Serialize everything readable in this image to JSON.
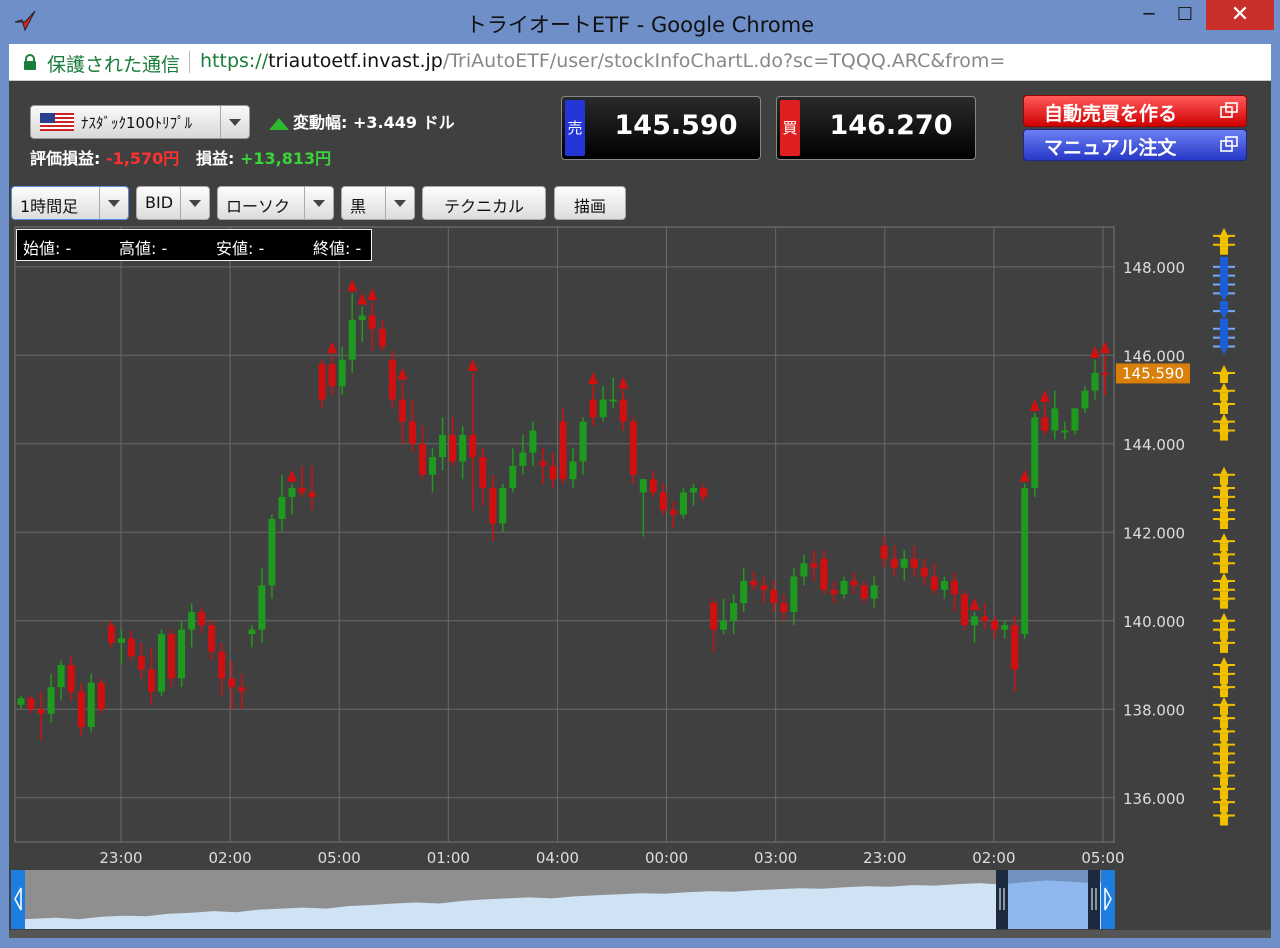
{
  "window": {
    "title": "トライオートETF - Google Chrome",
    "minimize": "─",
    "maximize": "☐",
    "close": "✕"
  },
  "address": {
    "secure_label": "保護された通信",
    "url_scheme": "https://",
    "url_host": "triautoetf.invast.jp",
    "url_path": "/TriAutoETF/user/stockInfoChartL.do?sc=TQQQ.ARC&from="
  },
  "header": {
    "symbol": "ﾅｽﾀﾞｯｸ100ﾄﾘﾌﾟﾙ",
    "change_label": "変動幅:",
    "change_value": "+3.449 ドル",
    "eval_label": "評価損益:",
    "eval_value": "-1,570円",
    "profit_label": "損益:",
    "profit_value": "+13,813円",
    "sell_tag": "売",
    "sell_price": "145.590",
    "buy_tag": "買",
    "buy_price": "146.270",
    "auto_button": "自動売買を作る",
    "manual_button": "マニュアル注文"
  },
  "toolbar": {
    "timeframe": "1時間足",
    "price_type": "BID",
    "chart_style": "ローソク",
    "theme": "黒",
    "technical": "テクニカル",
    "draw": "描画"
  },
  "ohlc": {
    "open": "始値: -",
    "high": "高値: -",
    "low": "安値: -",
    "close": "終値: -"
  },
  "colors": {
    "background": "#404040",
    "grid": "#6a6a6a",
    "up": "#1e9a1e",
    "down": "#d01010",
    "order_marker": "#f0c000",
    "price_tag": "#d9800a",
    "position_marker": "#1a5fd8"
  },
  "chart_data": {
    "type": "candlestick",
    "price_tag": "145.590",
    "ylim": [
      135.0,
      148.9
    ],
    "y_ticks": [
      "148.000",
      "146.000",
      "144.000",
      "142.000",
      "140.000",
      "138.000",
      "136.000"
    ],
    "y_tick_values": [
      148,
      146,
      144,
      142,
      140,
      138,
      136
    ],
    "x_ticks": [
      "23:00",
      "02:00",
      "05:00",
      "01:00",
      "04:00",
      "00:00",
      "03:00",
      "23:00",
      "02:00",
      "05:00"
    ],
    "candles": [
      [
        138.1,
        138.3,
        138.0,
        138.25
      ],
      [
        138.25,
        138.3,
        137.9,
        138.0
      ],
      [
        138.0,
        138.4,
        137.3,
        137.9
      ],
      [
        137.9,
        138.8,
        137.7,
        138.5
      ],
      [
        138.5,
        139.1,
        138.2,
        139.0
      ],
      [
        139.0,
        139.2,
        138.2,
        138.4
      ],
      [
        138.4,
        138.6,
        137.4,
        137.6
      ],
      [
        137.6,
        138.8,
        137.5,
        138.6
      ],
      [
        138.6,
        138.7,
        137.9,
        138.0
      ],
      [
        139.9,
        140.0,
        139.4,
        139.5
      ],
      [
        139.5,
        139.8,
        139.0,
        139.6
      ],
      [
        139.6,
        139.8,
        139.1,
        139.2
      ],
      [
        139.2,
        139.5,
        138.7,
        138.9
      ],
      [
        138.9,
        139.4,
        138.1,
        138.4
      ],
      [
        138.4,
        139.8,
        138.3,
        139.7
      ],
      [
        139.7,
        139.8,
        138.5,
        138.7
      ],
      [
        138.7,
        140.0,
        138.5,
        139.8
      ],
      [
        139.8,
        140.4,
        139.4,
        140.2
      ],
      [
        140.2,
        140.3,
        139.7,
        139.9
      ],
      [
        139.9,
        140.0,
        139.1,
        139.3
      ],
      [
        139.3,
        139.5,
        138.3,
        138.7
      ],
      [
        138.7,
        139.1,
        138.0,
        138.5
      ],
      [
        138.5,
        138.8,
        138.0,
        138.4
      ],
      [
        139.7,
        139.9,
        139.4,
        139.8
      ],
      [
        139.8,
        141.2,
        139.5,
        140.8
      ],
      [
        140.8,
        142.4,
        140.5,
        142.3
      ],
      [
        142.3,
        143.3,
        142.0,
        142.8
      ],
      [
        142.8,
        143.1,
        142.4,
        143.0
      ],
      [
        143.0,
        143.5,
        142.8,
        142.9
      ],
      [
        142.9,
        143.5,
        142.5,
        142.8
      ],
      [
        145.8,
        145.9,
        144.8,
        145.0
      ],
      [
        145.8,
        146.0,
        145.1,
        145.3
      ],
      [
        145.3,
        146.2,
        145.1,
        145.9
      ],
      [
        145.9,
        147.4,
        145.6,
        146.8
      ],
      [
        146.8,
        147.1,
        146.3,
        146.9
      ],
      [
        146.9,
        147.2,
        146.1,
        146.6
      ],
      [
        146.6,
        146.8,
        146.1,
        146.2
      ],
      [
        145.9,
        146.1,
        144.8,
        145.0
      ],
      [
        145.0,
        145.4,
        144.0,
        144.5
      ],
      [
        144.5,
        145.0,
        143.8,
        144.0
      ],
      [
        144.0,
        144.4,
        143.2,
        143.3
      ],
      [
        143.3,
        143.9,
        142.9,
        143.7
      ],
      [
        143.7,
        144.6,
        143.4,
        144.2
      ],
      [
        144.2,
        144.6,
        143.5,
        143.6
      ],
      [
        143.6,
        144.4,
        143.2,
        144.2
      ],
      [
        144.2,
        145.6,
        142.5,
        143.7
      ],
      [
        143.7,
        143.9,
        142.6,
        143.0
      ],
      [
        143.0,
        143.3,
        141.8,
        142.2
      ],
      [
        142.2,
        143.1,
        142.0,
        143.0
      ],
      [
        143.0,
        143.9,
        142.9,
        143.5
      ],
      [
        143.5,
        144.2,
        143.3,
        143.8
      ],
      [
        143.8,
        144.5,
        143.5,
        144.3
      ],
      [
        143.6,
        143.9,
        143.1,
        143.5
      ],
      [
        143.5,
        143.8,
        143.0,
        143.2
      ],
      [
        144.5,
        144.8,
        143.1,
        143.2
      ],
      [
        143.2,
        143.9,
        143.0,
        143.6
      ],
      [
        143.6,
        144.6,
        143.3,
        144.5
      ],
      [
        145.0,
        145.3,
        144.4,
        144.6
      ],
      [
        144.6,
        145.3,
        144.5,
        145.0
      ],
      [
        145.0,
        145.5,
        144.8,
        145.0
      ],
      [
        145.0,
        145.2,
        144.3,
        144.5
      ],
      [
        144.5,
        144.6,
        143.1,
        143.3
      ],
      [
        142.9,
        143.2,
        141.9,
        143.2
      ],
      [
        143.2,
        143.4,
        142.8,
        142.9
      ],
      [
        142.9,
        143.1,
        142.4,
        142.5
      ],
      [
        142.5,
        142.7,
        142.1,
        142.4
      ],
      [
        142.4,
        143.0,
        142.3,
        142.9
      ],
      [
        142.9,
        143.1,
        142.6,
        143.0
      ],
      [
        143.0,
        143.1,
        142.7,
        142.8
      ],
      [
        140.4,
        140.5,
        139.3,
        139.8
      ],
      [
        139.8,
        140.5,
        139.7,
        140.0
      ],
      [
        140.0,
        140.6,
        139.7,
        140.4
      ],
      [
        140.4,
        141.2,
        140.2,
        140.9
      ],
      [
        140.9,
        141.1,
        140.7,
        140.8
      ],
      [
        140.8,
        141.0,
        140.4,
        140.7
      ],
      [
        140.7,
        140.9,
        140.2,
        140.4
      ],
      [
        140.4,
        140.6,
        140.0,
        140.2
      ],
      [
        140.2,
        141.2,
        139.9,
        141.0
      ],
      [
        141.0,
        141.5,
        140.8,
        141.3
      ],
      [
        141.3,
        141.6,
        140.9,
        141.2
      ],
      [
        141.4,
        141.6,
        140.6,
        140.7
      ],
      [
        140.7,
        140.9,
        140.4,
        140.6
      ],
      [
        140.6,
        141.0,
        140.5,
        140.9
      ],
      [
        140.9,
        141.1,
        140.6,
        140.8
      ],
      [
        140.8,
        140.9,
        140.4,
        140.5
      ],
      [
        140.5,
        141.0,
        140.3,
        140.8
      ],
      [
        141.7,
        141.9,
        141.2,
        141.4
      ],
      [
        141.4,
        141.7,
        141.0,
        141.2
      ],
      [
        141.2,
        141.6,
        140.9,
        141.4
      ],
      [
        141.4,
        141.7,
        141.0,
        141.2
      ],
      [
        141.2,
        141.4,
        140.8,
        141.0
      ],
      [
        141.0,
        141.3,
        140.6,
        140.7
      ],
      [
        140.7,
        141.0,
        140.5,
        140.9
      ],
      [
        140.9,
        141.1,
        140.2,
        140.6
      ],
      [
        140.6,
        140.7,
        139.8,
        139.9
      ],
      [
        139.9,
        140.2,
        139.5,
        140.1
      ],
      [
        140.1,
        140.4,
        139.8,
        140.0
      ],
      [
        140.0,
        140.1,
        139.6,
        139.8
      ],
      [
        139.8,
        140.0,
        139.6,
        139.9
      ],
      [
        139.9,
        140.1,
        138.4,
        138.9
      ],
      [
        139.7,
        143.1,
        139.6,
        143.0
      ],
      [
        143.0,
        144.7,
        142.8,
        144.6
      ],
      [
        144.6,
        144.9,
        144.2,
        144.3
      ],
      [
        144.3,
        145.2,
        144.1,
        144.8
      ],
      [
        144.3,
        144.5,
        144.1,
        144.3
      ],
      [
        144.3,
        144.8,
        144.2,
        144.8
      ],
      [
        144.8,
        145.3,
        144.7,
        145.2
      ],
      [
        145.2,
        145.9,
        145.0,
        145.6
      ],
      [
        145.6,
        146.0,
        145.1,
        145.59
      ]
    ],
    "sell_marks": [
      27,
      31,
      33,
      34,
      35,
      38,
      45,
      57,
      60,
      95,
      100,
      101,
      102,
      107,
      108
    ],
    "order_levels": [
      148.7,
      148.5,
      145.6,
      145.2,
      144.9,
      144.5,
      144.3,
      143.3,
      143.0,
      142.8,
      142.5,
      142.3,
      141.8,
      141.5,
      141.3,
      140.9,
      140.7,
      140.5,
      140.0,
      139.8,
      139.5,
      139.0,
      138.8,
      138.5,
      138.1,
      137.8,
      137.5,
      137.2,
      137.0,
      136.8,
      136.5,
      136.2,
      135.9,
      135.6
    ],
    "position_levels": [
      148.0,
      147.8,
      147.6,
      147.4,
      147.0,
      146.6,
      146.4,
      146.2
    ],
    "navigator": [
      0.18,
      0.2,
      0.22,
      0.19,
      0.24,
      0.26,
      0.25,
      0.3,
      0.32,
      0.35,
      0.33,
      0.38,
      0.4,
      0.42,
      0.4,
      0.45,
      0.47,
      0.5,
      0.52,
      0.5,
      0.55,
      0.58,
      0.6,
      0.62,
      0.6,
      0.64,
      0.66,
      0.68,
      0.7,
      0.69,
      0.72,
      0.74,
      0.73,
      0.76,
      0.78,
      0.8,
      0.79,
      0.82,
      0.84,
      0.83,
      0.86,
      0.85,
      0.88,
      0.9,
      0.87,
      0.92,
      0.95,
      0.93,
      0.9,
      0.94
    ]
  }
}
